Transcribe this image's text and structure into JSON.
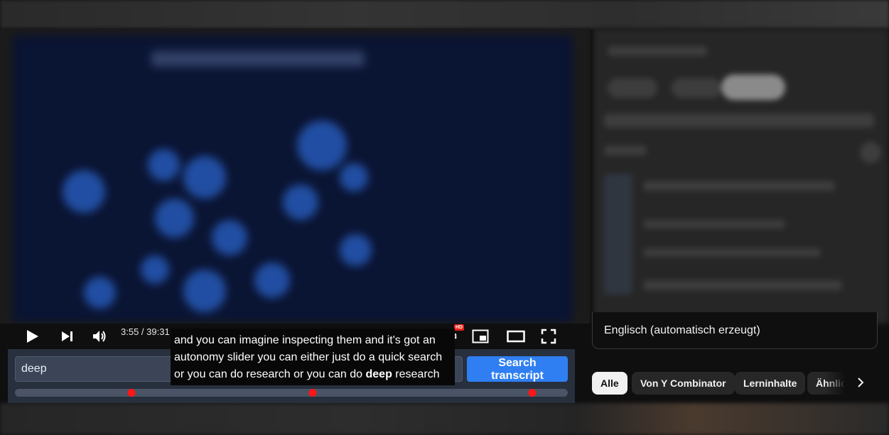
{
  "player": {
    "time_display": "3:55 / 39:31",
    "hd_badge": "HD",
    "icons": [
      "play-icon",
      "next-icon",
      "volume-icon",
      "settings-icon",
      "miniplayer-icon",
      "theater-icon",
      "fullscreen-icon"
    ]
  },
  "caption": {
    "line1": "and you can imagine inspecting them and it's got an",
    "line2": "autonomy slider you can either just do a quick search",
    "line3_before": "or you can do research or you can do ",
    "line3_highlight": "deep",
    "line3_after": " research"
  },
  "transcript_search": {
    "query": "deep",
    "button_label": "Search transcript",
    "match_positions": [
      0.211,
      0.538,
      0.936
    ],
    "marker_color": "#ff1616",
    "button_color": "#2f7ff2"
  },
  "sidebar": {
    "language_label": "Englisch (automatisch erzeugt)",
    "chips": [
      "Alle",
      "Von Y Combinator",
      "Lerninhalte",
      "Ähnlich"
    ],
    "active_chip": "Alle"
  }
}
